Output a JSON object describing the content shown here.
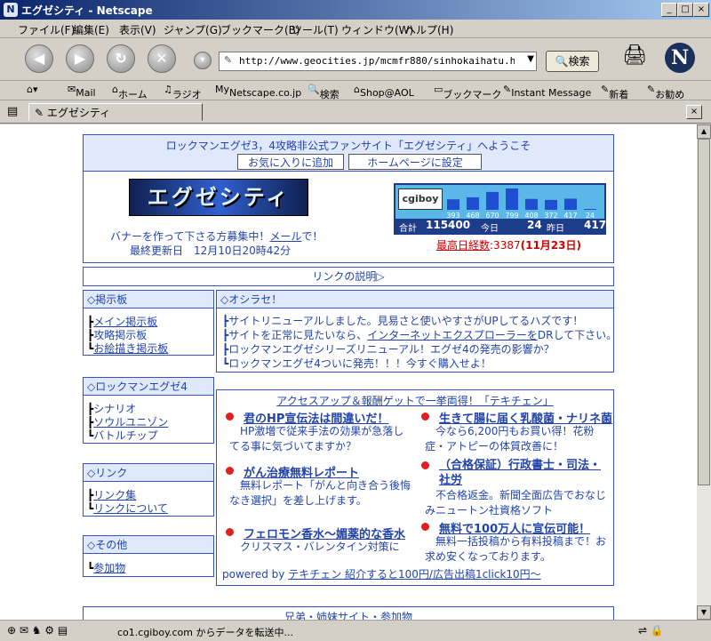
{
  "window": {
    "title": "エグゼシティ - Netscape"
  },
  "menu": [
    "ファイル(F)",
    "編集(E)",
    "表示(V)",
    "ジャンプ(G)",
    "ブックマーク(B)",
    "ツール(T)",
    "ウィンドウ(W)",
    "ヘルプ(H)"
  ],
  "nav": {
    "url": "http://www.geocities.jp/mcmfr880/sinhokaihatu.html",
    "search_label": "検索"
  },
  "bookmarks": [
    "Mail",
    "ホーム",
    "ラジオ",
    "Netscape.co.jp",
    "検索",
    "Shop@AOL",
    "ブックマーク",
    "Instant Message",
    "新着",
    "お勧め"
  ],
  "tab": {
    "label": "エグゼシティ"
  },
  "status": {
    "text": "co1.cgiboy.com からデータを転送中..."
  },
  "page": {
    "welcome": "ロックマンエグゼ3，4攻略非公式ファンサイト「エグゼシティ」へようこそ",
    "btn_fav": "お気に入りに追加",
    "btn_home": "ホームページに設定",
    "banner_text": "エグゼシティ",
    "banner_recruit_pre": "バナーを作って下さる方募集中！",
    "banner_recruit_link": "メール",
    "banner_recruit_post": "で！",
    "updated": "最終更新日　12月10日20時42分",
    "counter": {
      "logo": "cgiboy",
      "bars": [
        393,
        468,
        670,
        799,
        408,
        372,
        417,
        24
      ],
      "total_label": "合計",
      "total": "115400",
      "today_label": "今日",
      "today": "24",
      "yesterday_label": "昨日",
      "yesterday": "417"
    },
    "record_label": "最高日経数",
    "record_value": ":3387",
    "record_date": "(11月23日)",
    "link_desc": "リンクの説明▷",
    "board": {
      "title": "◇掲示板",
      "items": [
        "メイン掲示板",
        "攻略掲示板",
        "お絵描き掲示板"
      ]
    },
    "notice": {
      "title": "◇オシラセ！",
      "line1": "サイトリニューアルしました。見易さと使いやすさがUPしてるハズです！",
      "line2_pre": "サイトを正常に見たいなら、",
      "line2_link": "インターネットエクスプローラーを",
      "line2_post": "DRして下さい。",
      "line3": "ロックマンエグゼシリーズリニューアル！エグゼ4の発売の影響か？",
      "line4": "ロックマンエグゼ4ついに発売！！！今すぐ購入せよ！"
    },
    "rm4": {
      "title": "◇ロックマンエグゼ4",
      "items": [
        "シナリオ",
        "ソウルユニゾン",
        "バトルチップ"
      ]
    },
    "links": {
      "title": "◇リンク",
      "items": [
        "リンク集",
        "リンクについて"
      ]
    },
    "other": {
      "title": "◇その他",
      "items": [
        "参加物"
      ]
    },
    "ad": {
      "header": "アクセスアップ＆報酬ゲットで一挙両得！「テキチェン」",
      "items": [
        {
          "title": "君のHP宣伝法は間違いだ！",
          "text": "HP激増で従来手法の効果が急落してる事に気づいてますか？"
        },
        {
          "title": "生きて腸に届く乳酸菌・ナリネ菌",
          "text": "今なら6,200円もお買い得！花粉症・アトピーの体質改善に！"
        },
        {
          "title": "がん治療無料レポート",
          "text": "無料レポート「がんと向き合う後悔なき選択」を差し上げます。"
        },
        {
          "title": "（合格保証）行政書士・司法・社労",
          "text": "不合格返金。新聞全面広告でおなじみニュートン社資格ソフト"
        },
        {
          "title": "フェロモン香水～媚薬的な香水",
          "text": "クリスマス・バレンタイン対策に"
        },
        {
          "title": "無料で100万人に宣伝可能！",
          "text": "無料一括投稿から有料投稿まで！お求め安くなっております。"
        }
      ],
      "powered_pre": "powered by ",
      "powered_link": "テキチェン 紹介すると100円/広告出稿1click10円～"
    },
    "sister": "兄弟・姉妹サイト・参加物"
  }
}
